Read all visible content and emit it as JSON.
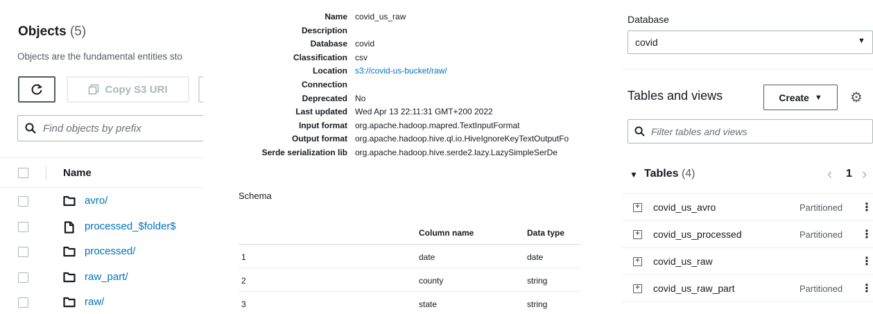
{
  "s3": {
    "title": "Objects",
    "count": "(5)",
    "description": "Objects are the fundamental entities sto",
    "copy_button": "Copy S3 URI",
    "search_placeholder": "Find objects by prefix",
    "column_name": "Name",
    "objects": [
      {
        "name": "avro/",
        "icon": "folder-icon"
      },
      {
        "name": "processed_$folder$",
        "icon": "file-icon"
      },
      {
        "name": "processed/",
        "icon": "folder-icon"
      },
      {
        "name": "raw_part/",
        "icon": "folder-icon"
      },
      {
        "name": "raw/",
        "icon": "folder-icon"
      }
    ]
  },
  "properties": [
    {
      "key": "Name",
      "value": "covid_us_raw"
    },
    {
      "key": "Description",
      "value": ""
    },
    {
      "key": "Database",
      "value": "covid"
    },
    {
      "key": "Classification",
      "value": "csv"
    },
    {
      "key": "Location",
      "value": "s3://covid-us-bucket/raw/"
    },
    {
      "key": "Connection",
      "value": ""
    },
    {
      "key": "Deprecated",
      "value": "No"
    },
    {
      "key": "Last updated",
      "value": "Wed Apr 13 22:11:31 GMT+200 2022"
    },
    {
      "key": "Input format",
      "value": "org.apache.hadoop.mapred.TextInputFormat"
    },
    {
      "key": "Output format",
      "value": "org.apache.hadoop.hive.ql.io.HiveIgnoreKeyTextOutputFo"
    },
    {
      "key": "Serde serialization lib",
      "value": "org.apache.hadoop.hive.serde2.lazy.LazySimpleSerDe"
    }
  ],
  "schema": {
    "label": "Schema",
    "col_name_header": "Column name",
    "data_type_header": "Data type",
    "rows": [
      {
        "n": "1",
        "name": "date",
        "type": "date"
      },
      {
        "n": "2",
        "name": "county",
        "type": "string"
      },
      {
        "n": "3",
        "name": "state",
        "type": "string"
      }
    ]
  },
  "athena": {
    "database_label": "Database",
    "database_value": "covid",
    "tables_and_views": "Tables and views",
    "create_label": "Create",
    "filter_placeholder": "Filter tables and views",
    "tables_label": "Tables",
    "tables_count": "(4)",
    "page": "1",
    "tables": [
      {
        "name": "covid_us_avro",
        "tag": "Partitioned"
      },
      {
        "name": "covid_us_processed",
        "tag": "Partitioned"
      },
      {
        "name": "covid_us_raw",
        "tag": ""
      },
      {
        "name": "covid_us_raw_part",
        "tag": "Partitioned"
      }
    ]
  },
  "colors": {
    "link": "#0073bb",
    "text": "#16191f",
    "muted": "#545b64",
    "border": "#aab7b8"
  }
}
